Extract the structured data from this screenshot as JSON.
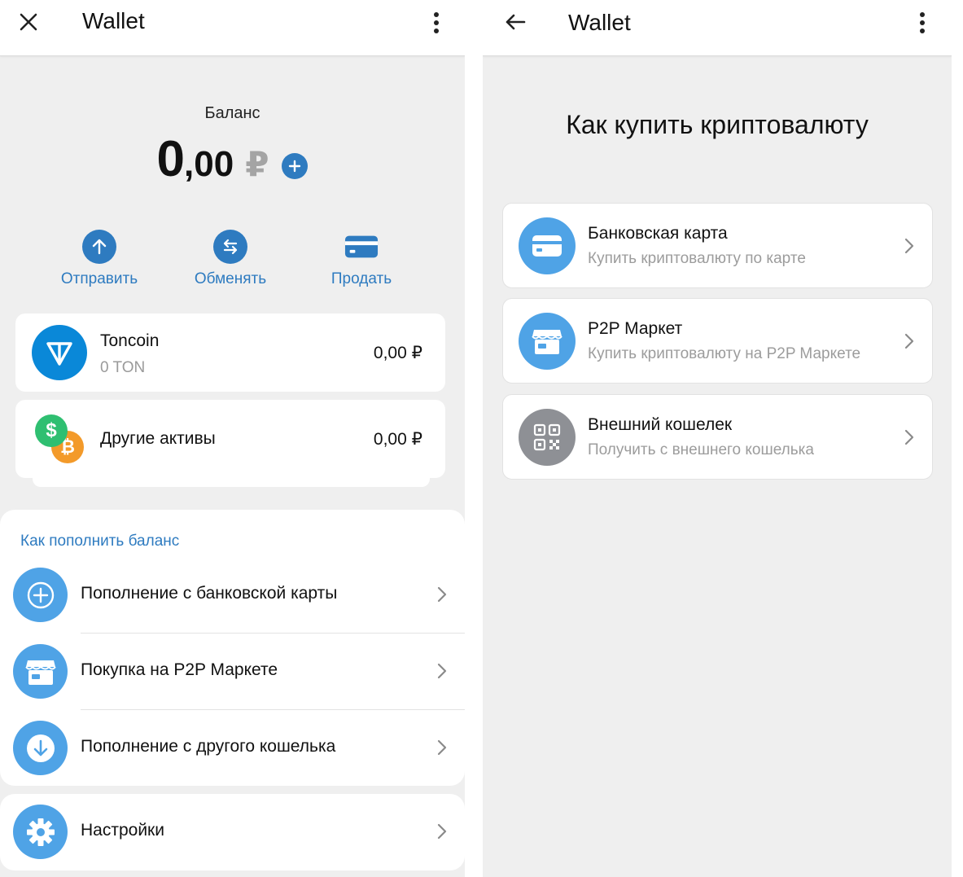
{
  "colors": {
    "accent": "#2e7bc0",
    "icon_blue": "#4fa3e6",
    "ton_blue": "#0a88d8",
    "muted": "#9a9a9a",
    "bg": "#efefef"
  },
  "left": {
    "header": {
      "title": "Wallet",
      "close_icon": "close-icon",
      "menu_icon": "more-vertical-icon"
    },
    "balance": {
      "label": "Баланс",
      "integer": "0",
      "decimal": ",00",
      "currency": "₽"
    },
    "actions": [
      {
        "label": "Отправить",
        "icon": "arrow-up-icon"
      },
      {
        "label": "Обменять",
        "icon": "swap-icon"
      },
      {
        "label": "Продать",
        "icon": "card-icon"
      }
    ],
    "assets": [
      {
        "name": "Toncoin",
        "amount": "0 TON",
        "value": "0,00 ₽",
        "icon": "toncoin-icon"
      },
      {
        "name": "Другие активы",
        "value": "0,00 ₽",
        "icon": "crypto-coins-icon"
      }
    ],
    "topup": {
      "title": "Как пополнить баланс",
      "items": [
        {
          "label": "Пополнение с банковской карты",
          "icon": "plus-circle-icon"
        },
        {
          "label": "Покупка на P2P Маркете",
          "icon": "store-icon"
        },
        {
          "label": "Пополнение с другого кошелька",
          "icon": "download-icon"
        }
      ]
    },
    "settings": {
      "label": "Настройки",
      "icon": "gear-icon"
    }
  },
  "right": {
    "header": {
      "title": "Wallet",
      "back_icon": "back-arrow-icon",
      "menu_icon": "more-vertical-icon"
    },
    "heading": "Как купить криптовалюту",
    "options": [
      {
        "title": "Банковская карта",
        "subtitle": "Купить криптовалюту по карте",
        "icon": "card-icon"
      },
      {
        "title": "P2P Маркет",
        "subtitle": "Купить криптовалюту на P2P Маркете",
        "icon": "store-icon"
      },
      {
        "title": "Внешний кошелек",
        "subtitle": "Получить с внешнего кошелька",
        "icon": "qr-code-icon"
      }
    ]
  }
}
